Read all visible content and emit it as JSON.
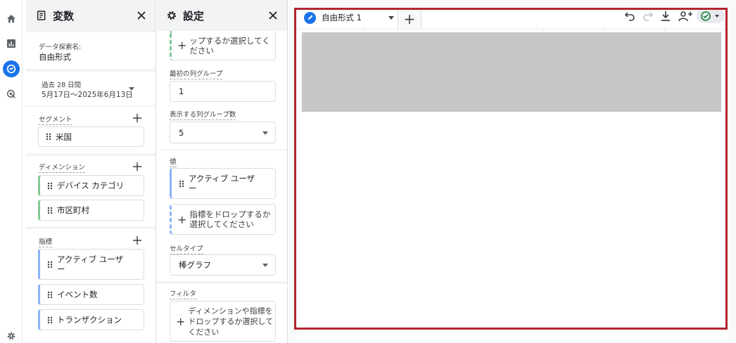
{
  "rail": {
    "items": [
      "home-icon",
      "reports-icon",
      "explore-icon",
      "advertising-icon",
      "settings-icon"
    ],
    "active": "explore-icon",
    "accent": "#1a73e8"
  },
  "variables": {
    "title": "変数",
    "exploration_label": "データ探索名:",
    "exploration_name": "自由形式",
    "date_range_label": "過去 28 日間",
    "date_range_value": "5月17日～2025年6月13日",
    "segments": {
      "label": "セグメント",
      "items": [
        "米国"
      ]
    },
    "dimensions": {
      "label": "ディメンション",
      "items": [
        "デバイス カテゴリ",
        "市区町村"
      ]
    },
    "metrics": {
      "label": "指標",
      "items": [
        "アクティブ ユーザー",
        "イベント数",
        "トランザクション"
      ]
    }
  },
  "settings": {
    "title": "設定",
    "top_drop_text": "ップするか選択してください",
    "first_column_group_label": "最初の列グループ",
    "first_column_group_value": "1",
    "column_groups_count_label": "表示する列グループ数",
    "column_groups_count_value": "5",
    "values_label": "値",
    "value_chip": "アクティブ ユーザー",
    "metric_drop_text": "指標をドロップするか選択してください",
    "cell_type_label": "セルタイプ",
    "cell_type_value": "棒グラフ",
    "filter_label": "フィルタ",
    "filter_drop_text": "ディメンションや指標をドロップするか選択してください"
  },
  "canvas": {
    "tab_label": "自由形式 1",
    "add_tab": "+",
    "toolbar": [
      "undo-icon",
      "redo-icon",
      "download-icon",
      "share-icon",
      "status-check-icon"
    ],
    "highlight_color": "#b3262d",
    "redaction_color": "#c6c6c6"
  }
}
